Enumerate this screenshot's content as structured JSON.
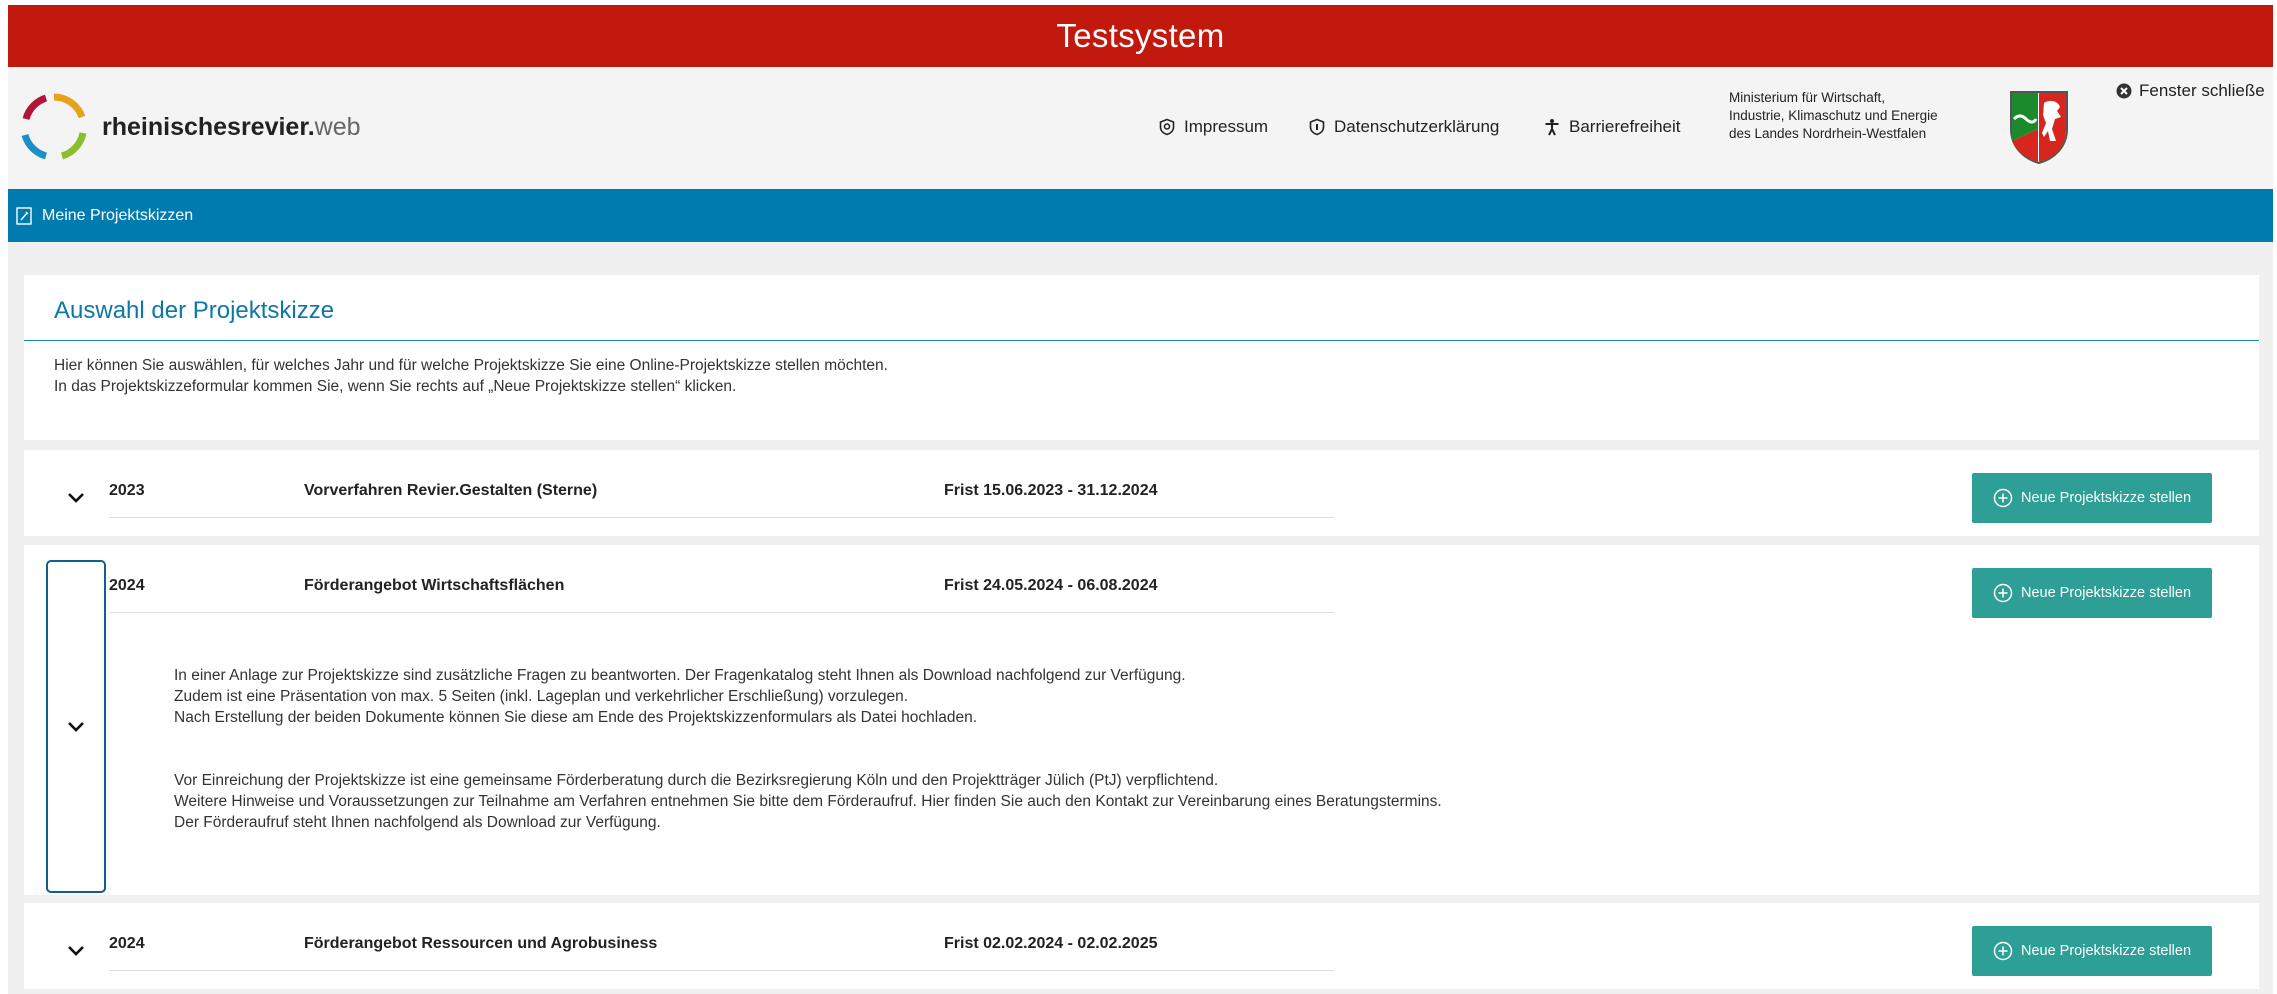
{
  "banner": {
    "title": "Testsystem"
  },
  "header": {
    "logo_bold": "rheinischesrevier.",
    "logo_light": "web",
    "nav": {
      "impressum": "Impressum",
      "datenschutz": "Datenschutzerklärung",
      "barriere": "Barrierefreiheit"
    },
    "ministry": [
      "Ministerium für Wirtschaft,",
      "Industrie, Klimaschutz und Energie",
      "des Landes Nordrhein-Westfalen"
    ],
    "close_label": "Fenster schließe"
  },
  "bluebar": {
    "label": "Meine Projektskizzen"
  },
  "intro": {
    "title": "Auswahl der Projektskizze",
    "lines": [
      "Hier können Sie auswählen, für welches Jahr und für welche Projektskizze Sie eine Online-Projektskizze stellen möchten.",
      "In das Projektskizzeformular kommen Sie, wenn Sie rechts auf „Neue Projektskizze stellen“ klicken."
    ]
  },
  "rows": [
    {
      "year": "2023",
      "name": "Vorverfahren Revier.Gestalten (Sterne)",
      "frist": "Frist 15.06.2023 - 31.12.2024",
      "button": "Neue Projektskizze stellen"
    },
    {
      "year": "2024",
      "name": "Förderangebot Wirtschaftsflächen",
      "frist": "Frist 24.05.2024 - 06.08.2024",
      "button": "Neue Projektskizze stellen",
      "details": [
        "In einer Anlage zur Projektskizze sind zusätzliche Fragen zu beantworten. Der Fragenkatalog steht Ihnen als Download nachfolgend zur Verfügung.",
        "Zudem ist eine Präsentation von max. 5 Seiten (inkl. Lageplan und verkehrlicher Erschließung) vorzulegen.",
        "Nach Erstellung der beiden Dokumente können Sie diese am Ende des Projektskizzenformulars als Datei hochladen.",
        "Vor Einreichung der Projektskizze ist eine gemeinsame Förderberatung durch die Bezirksregierung Köln und den Projektträger Jülich (PtJ) verpflichtend.",
        "Weitere Hinweise und Voraussetzungen zur Teilnahme am Verfahren entnehmen Sie bitte dem Förderaufruf. Hier finden Sie auch den Kontakt zur Vereinbarung eines Beratungstermins.",
        "Der Förderaufruf steht Ihnen nachfolgend als Download zur Verfügung."
      ]
    },
    {
      "year": "2024",
      "name": "Förderangebot Ressourcen und Agrobusiness",
      "frist": "Frist 02.02.2024 - 02.02.2025",
      "button": "Neue Projektskizze stellen"
    }
  ],
  "colors": {
    "banner": "#c2190f",
    "bluebar": "#007bb0",
    "title": "#0d77a8",
    "button": "#2d9f97"
  }
}
